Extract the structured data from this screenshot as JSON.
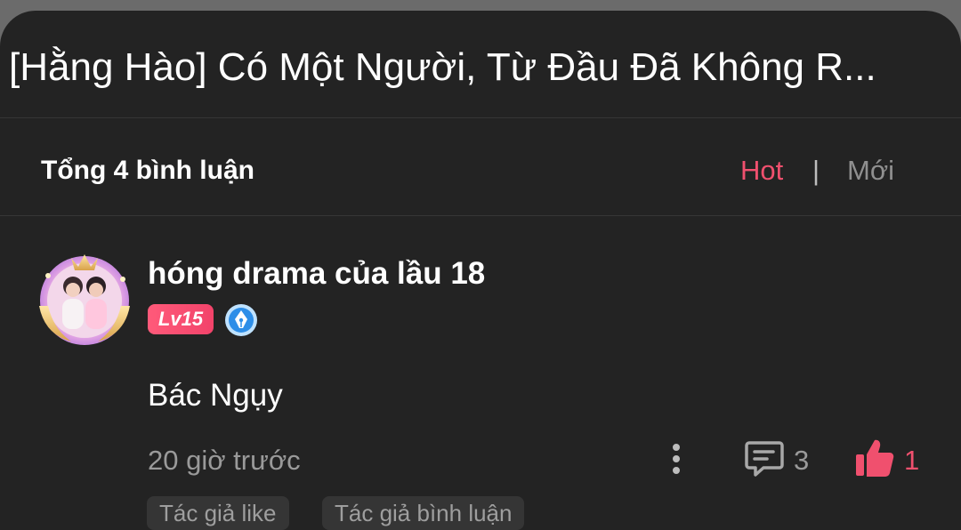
{
  "post": {
    "title": "[Hằng Hào] Có Một Người, Từ Đầu Đã Không R..."
  },
  "comments_header": {
    "summary": "Tổng 4 bình luận",
    "sort_hot": "Hot",
    "sort_separator": "|",
    "sort_new": "Mới",
    "active_color": "#f0506e"
  },
  "comment": {
    "username": "hóng drama của lầu 18",
    "level_badge": "Lv15",
    "verified_icon": "pen-nib-icon",
    "text": "Bác Ngụy",
    "time": "20 giờ trước",
    "reply_count": "3",
    "like_count": "1",
    "tags": [
      "Tác giả like",
      "Tác giả bình luận"
    ]
  },
  "icons": {
    "more": "more-vertical-icon",
    "reply": "comment-icon",
    "like": "thumbs-up-icon"
  }
}
